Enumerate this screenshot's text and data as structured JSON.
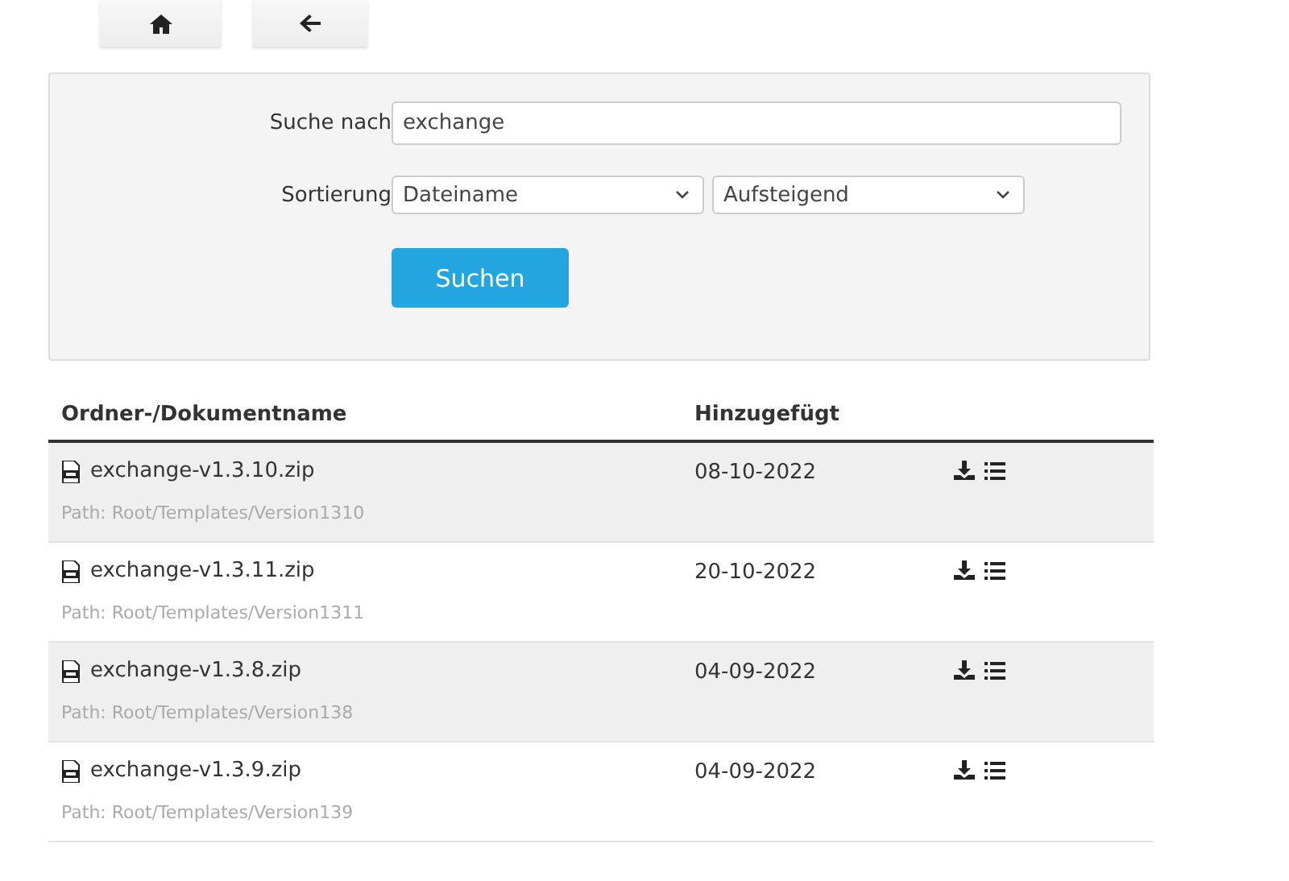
{
  "nav_buttons": [
    {
      "kind": "home"
    },
    {
      "kind": "back"
    }
  ],
  "search": {
    "label": "Suche nach",
    "value": "exchange"
  },
  "sort": {
    "label": "Sortierung",
    "field": "Dateiname",
    "order": "Aufsteigend"
  },
  "submit": "Suchen",
  "table": {
    "columns": [
      "Ordner-/Dokumentname",
      "Hinzugefügt"
    ],
    "rows": [
      {
        "name": "exchange-v1.3.10.zip",
        "path": "Path: Root/Templates/Version1310",
        "date": "08-10-2022"
      },
      {
        "name": "exchange-v1.3.11.zip",
        "path": "Path: Root/Templates/Version1311",
        "date": "20-10-2022"
      },
      {
        "name": "exchange-v1.3.8.zip",
        "path": "Path: Root/Templates/Version138",
        "date": "04-09-2022"
      },
      {
        "name": "exchange-v1.3.9.zip",
        "path": "Path: Root/Templates/Version139",
        "date": "04-09-2022"
      }
    ]
  }
}
